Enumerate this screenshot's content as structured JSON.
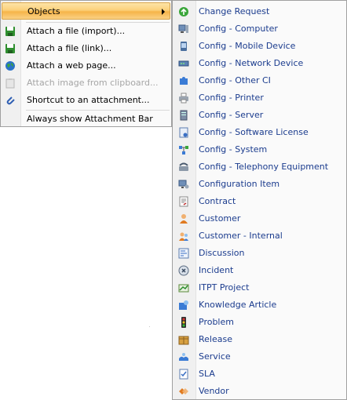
{
  "main_menu": {
    "items": [
      {
        "label": "Objects",
        "icon": "none",
        "state": "highlighted",
        "has_submenu": true
      },
      {
        "label": "Attach a file (import)...",
        "icon": "floppy-disk-icon"
      },
      {
        "label": "Attach a file (link)...",
        "icon": "floppy-disk-icon"
      },
      {
        "label": "Attach a web page...",
        "icon": "globe-icon"
      },
      {
        "label": "Attach image from clipboard...",
        "icon": "clipboard-image-icon",
        "state": "disabled"
      },
      {
        "label": "Shortcut to an attachment...",
        "icon": "paperclip-icon"
      },
      {
        "label": "Always show Attachment Bar",
        "icon": "none"
      }
    ]
  },
  "objects_submenu": {
    "items": [
      {
        "label": "Change Request",
        "icon": "change-request-icon"
      },
      {
        "label": "Config - Computer",
        "icon": "computer-icon"
      },
      {
        "label": "Config - Mobile Device",
        "icon": "mobile-device-icon"
      },
      {
        "label": "Config - Network Device",
        "icon": "network-device-icon"
      },
      {
        "label": "Config - Other CI",
        "icon": "puzzle-icon"
      },
      {
        "label": "Config - Printer",
        "icon": "printer-icon"
      },
      {
        "label": "Config - Server",
        "icon": "server-icon"
      },
      {
        "label": "Config - Software License",
        "icon": "software-license-icon"
      },
      {
        "label": "Config - System",
        "icon": "system-icon"
      },
      {
        "label": "Config - Telephony Equipment",
        "icon": "telephone-icon"
      },
      {
        "label": "Configuration Item",
        "icon": "configuration-item-icon"
      },
      {
        "label": "Contract",
        "icon": "contract-icon"
      },
      {
        "label": "Customer",
        "icon": "customer-icon"
      },
      {
        "label": "Customer - Internal",
        "icon": "customer-internal-icon"
      },
      {
        "label": "Discussion",
        "icon": "discussion-icon"
      },
      {
        "label": "Incident",
        "icon": "incident-icon"
      },
      {
        "label": "ITPT Project",
        "icon": "project-icon"
      },
      {
        "label": "Knowledge Article",
        "icon": "knowledge-article-icon"
      },
      {
        "label": "Problem",
        "icon": "problem-icon"
      },
      {
        "label": "Release",
        "icon": "release-icon"
      },
      {
        "label": "Service",
        "icon": "service-icon"
      },
      {
        "label": "SLA",
        "icon": "sla-icon"
      },
      {
        "label": "Vendor",
        "icon": "vendor-icon"
      }
    ]
  },
  "colors": {
    "highlight": "#fbd07a",
    "submenu_text": "#1b3c8e",
    "disabled_text": "#a6a6a6"
  }
}
